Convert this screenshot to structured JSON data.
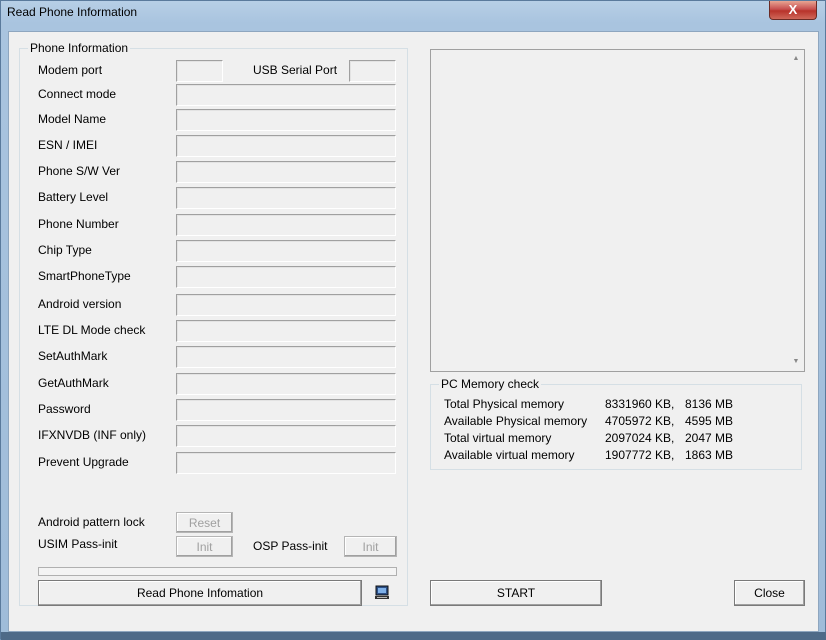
{
  "window": {
    "title": "Read Phone Information",
    "close_glyph": "X"
  },
  "phone_info": {
    "legend": "Phone Information",
    "modem_port": "Modem port",
    "usb_serial_port": "USB Serial Port",
    "rows": [
      {
        "label": "Connect mode",
        "value": ""
      },
      {
        "label": "Model Name",
        "value": ""
      },
      {
        "label": "ESN / IMEI",
        "value": ""
      },
      {
        "label": "Phone S/W Ver",
        "value": ""
      },
      {
        "label": "Battery Level",
        "value": ""
      },
      {
        "label": "Phone Number",
        "value": ""
      },
      {
        "label": "Chip Type",
        "value": ""
      },
      {
        "label": "SmartPhoneType",
        "value": ""
      },
      {
        "label": "Android version",
        "value": ""
      },
      {
        "label": "LTE DL Mode check",
        "value": ""
      },
      {
        "label": "SetAuthMark",
        "value": ""
      },
      {
        "label": "GetAuthMark",
        "value": ""
      },
      {
        "label": "Password",
        "value": ""
      },
      {
        "label": "IFXNVDB (INF only)",
        "value": ""
      },
      {
        "label": "Prevent Upgrade",
        "value": ""
      }
    ],
    "android_pattern_lock": "Android pattern lock",
    "reset_button": "Reset",
    "usim_pass_init": "USIM Pass-init",
    "init_button": "Init",
    "osp_pass_init": "OSP Pass-init",
    "osp_init_button": "Init",
    "read_button": "Read Phone Infomation",
    "computer_icon": "computer-icon"
  },
  "pc_memory": {
    "legend": "PC Memory check",
    "rows": [
      {
        "label": "Total Physical memory",
        "kb": "8331960 KB,",
        "mb": "8136 MB"
      },
      {
        "label": "Available Physical memory",
        "kb": "4705972 KB,",
        "mb": "4595 MB"
      },
      {
        "label": "Total virtual memory",
        "kb": "2097024 KB,",
        "mb": "2047 MB"
      },
      {
        "label": "Available virtual memory",
        "kb": "1907772 KB,",
        "mb": "1863 MB"
      }
    ]
  },
  "actions": {
    "start": "START",
    "close": "Close"
  }
}
